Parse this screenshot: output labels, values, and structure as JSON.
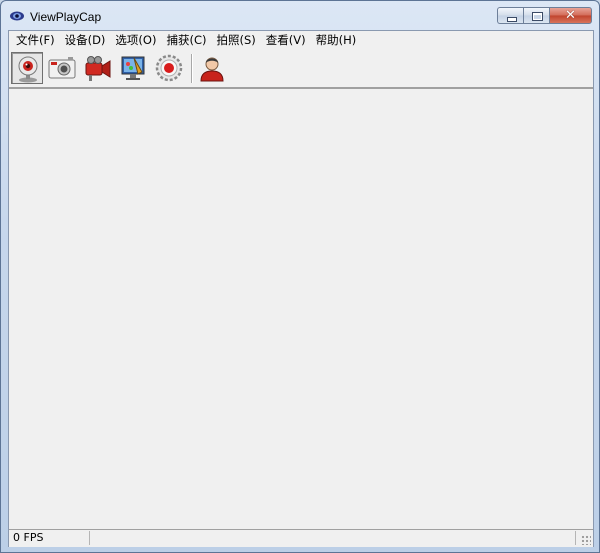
{
  "window": {
    "title": "ViewPlayCap"
  },
  "menu": [
    "文件(F)",
    "设备(D)",
    "选项(O)",
    "捕获(C)",
    "拍照(S)",
    "查看(V)",
    "帮助(H)"
  ],
  "toolbar": {
    "buttons": [
      {
        "name": "webcam-preview",
        "icon": "webcam-icon",
        "pressed": true
      },
      {
        "name": "snapshot",
        "icon": "camera-icon",
        "pressed": false
      },
      {
        "name": "video-camera",
        "icon": "video-camera-icon",
        "pressed": false
      },
      {
        "name": "display-settings",
        "icon": "monitor-paint-icon",
        "pressed": false
      },
      {
        "name": "record",
        "icon": "record-icon",
        "pressed": false
      },
      {
        "name": "user",
        "icon": "user-icon",
        "pressed": false
      }
    ]
  },
  "status": {
    "fps": "0 FPS",
    "message": ""
  },
  "colors": {
    "record_red": "#d81c1c",
    "titlebar": "#c7d7ec",
    "client_bg": "#f0f0f0"
  }
}
